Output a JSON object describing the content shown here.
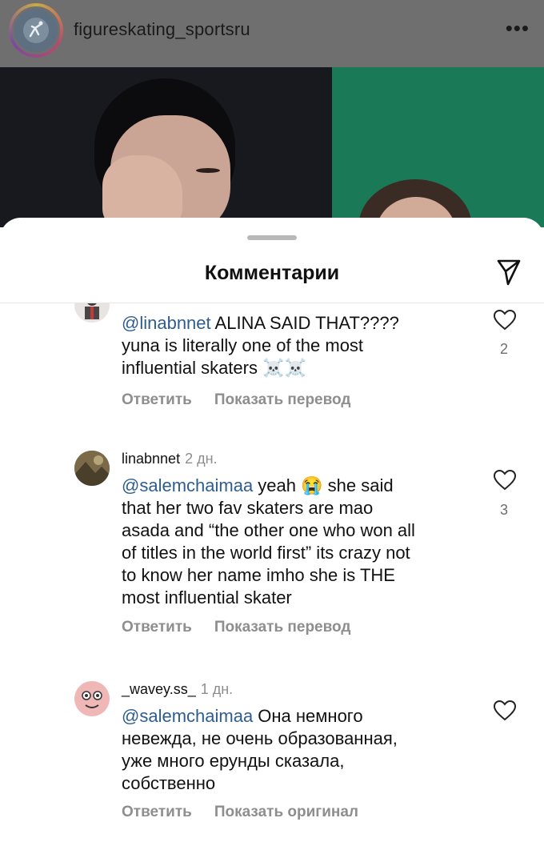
{
  "post": {
    "account_name": "figureskating_sportsru",
    "more_icon": "more-horizontal-icon"
  },
  "sheet": {
    "title": "Комментарии",
    "share_icon": "send-icon"
  },
  "comments": [
    {
      "username": "",
      "time": "",
      "mention": "@linabnnet",
      "text": " ALINA SAID THAT????\nyuna is literally one of the most\ninfluential skaters ☠️☠️",
      "likes": "2",
      "reply_label": "Ответить",
      "translate_label": "Показать перевод"
    },
    {
      "username": "linabnnet",
      "time": "2 дн.",
      "mention": "@salemchaimaa",
      "text": " yeah 😭 she said\nthat her two fav skaters are mao\nasada and “the other one who won all\nof titles in the world first” its crazy not\nto know her name imho she is THE\nmost influential skater",
      "likes": "3",
      "reply_label": "Ответить",
      "translate_label": "Показать перевод"
    },
    {
      "username": "_wavey.ss_",
      "time": "1 дн.",
      "mention": "@salemchaimaa",
      "text": " Она немного\nневежда, не очень образованная,\nуже много ерунды сказала,\nсобственно",
      "likes": "",
      "reply_label": "Ответить",
      "translate_label": "Показать оригинал"
    }
  ],
  "colors": {
    "mention": "#2e5d8f",
    "muted": "#8e8e8e",
    "dim_overlay": "#6f6f6f"
  }
}
